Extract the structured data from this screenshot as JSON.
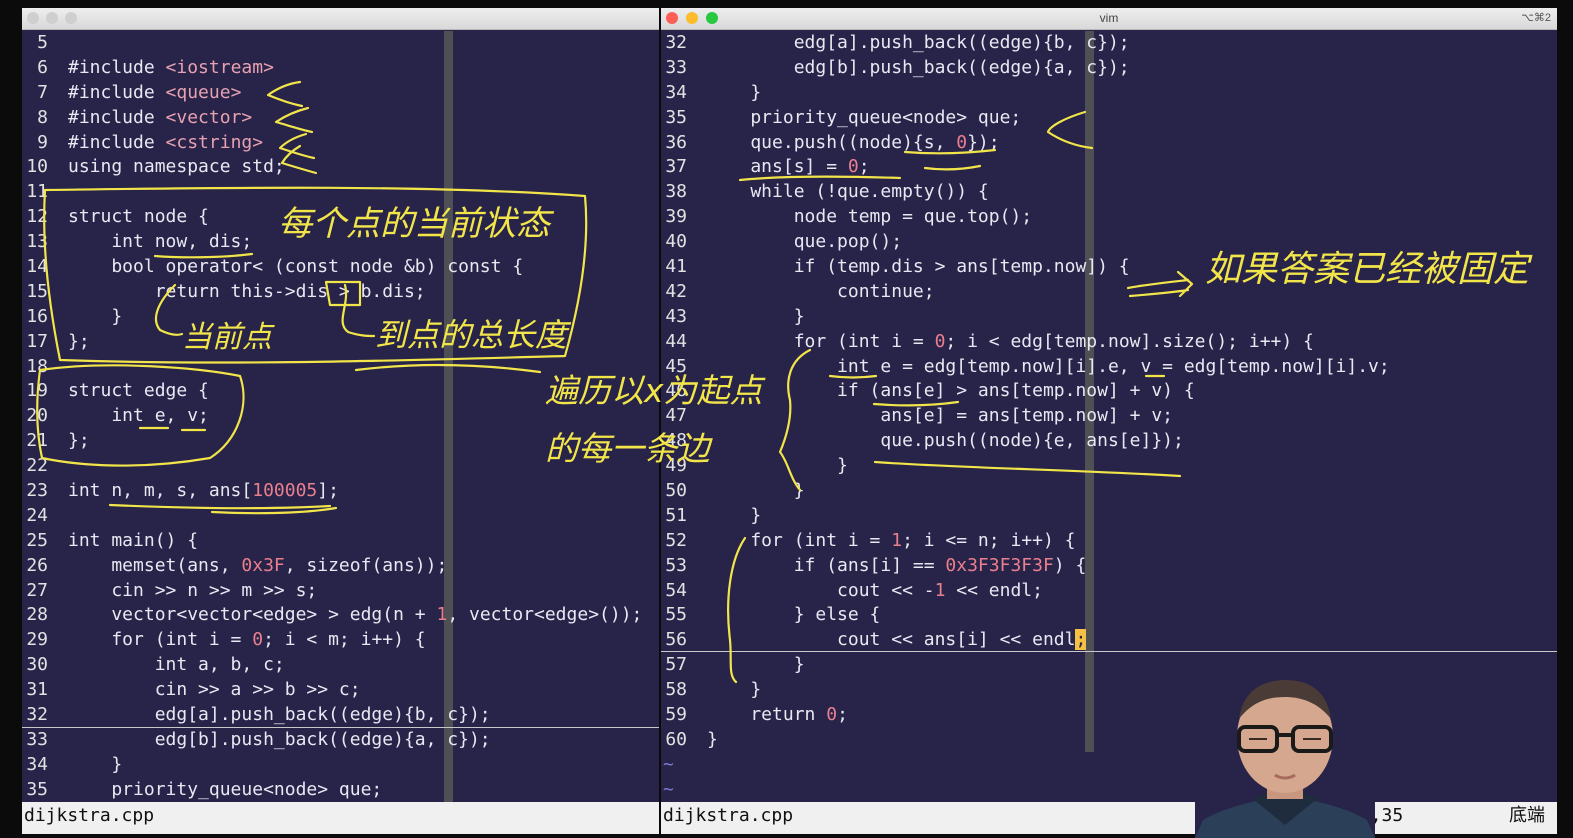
{
  "left_pane": {
    "file_name": "dijkstra.cpp",
    "lines": [
      {
        "n": "5",
        "segs": []
      },
      {
        "n": "6",
        "segs": [
          {
            "t": "#include ",
            "c": "k"
          },
          {
            "t": "<iostream>",
            "c": "s"
          }
        ]
      },
      {
        "n": "7",
        "segs": [
          {
            "t": "#include ",
            "c": "k"
          },
          {
            "t": "<queue>",
            "c": "s"
          }
        ]
      },
      {
        "n": "8",
        "segs": [
          {
            "t": "#include ",
            "c": "k"
          },
          {
            "t": "<vector>",
            "c": "s"
          }
        ]
      },
      {
        "n": "9",
        "segs": [
          {
            "t": "#include ",
            "c": "k"
          },
          {
            "t": "<cstring>",
            "c": "s"
          }
        ]
      },
      {
        "n": "10",
        "segs": [
          {
            "t": "using namespace std;",
            "c": "k"
          }
        ]
      },
      {
        "n": "11",
        "segs": []
      },
      {
        "n": "12",
        "segs": [
          {
            "t": "struct node {",
            "c": "k"
          }
        ]
      },
      {
        "n": "13",
        "segs": [
          {
            "t": "    int now, dis;",
            "c": "k"
          }
        ]
      },
      {
        "n": "14",
        "segs": [
          {
            "t": "    bool operator< (const node &b) const {",
            "c": "k"
          }
        ]
      },
      {
        "n": "15",
        "segs": [
          {
            "t": "        return this->dis > b.dis;",
            "c": "k"
          }
        ]
      },
      {
        "n": "16",
        "segs": [
          {
            "t": "    }",
            "c": "k"
          }
        ]
      },
      {
        "n": "17",
        "segs": [
          {
            "t": "};",
            "c": "k"
          }
        ]
      },
      {
        "n": "18",
        "segs": []
      },
      {
        "n": "19",
        "segs": [
          {
            "t": "struct edge {",
            "c": "k"
          }
        ]
      },
      {
        "n": "20",
        "segs": [
          {
            "t": "    int e, v;",
            "c": "k"
          }
        ]
      },
      {
        "n": "21",
        "segs": [
          {
            "t": "};",
            "c": "k"
          }
        ]
      },
      {
        "n": "22",
        "segs": []
      },
      {
        "n": "23",
        "segs": [
          {
            "t": "int n, m, s, ans[",
            "c": "k"
          },
          {
            "t": "100005",
            "c": "n"
          },
          {
            "t": "];",
            "c": "k"
          }
        ]
      },
      {
        "n": "24",
        "segs": []
      },
      {
        "n": "25",
        "segs": [
          {
            "t": "int main() {",
            "c": "k"
          }
        ]
      },
      {
        "n": "26",
        "segs": [
          {
            "t": "    memset(ans, ",
            "c": "k"
          },
          {
            "t": "0x3F",
            "c": "n"
          },
          {
            "t": ", sizeof(ans));",
            "c": "k"
          }
        ]
      },
      {
        "n": "27",
        "segs": [
          {
            "t": "    cin >> n >> m >> s;",
            "c": "k"
          }
        ]
      },
      {
        "n": "28",
        "segs": [
          {
            "t": "    vector<vector<edge> > edg(n + ",
            "c": "k"
          },
          {
            "t": "1",
            "c": "n"
          },
          {
            "t": ", vector<edge>());",
            "c": "k"
          }
        ]
      },
      {
        "n": "29",
        "segs": [
          {
            "t": "    for (int i = ",
            "c": "k"
          },
          {
            "t": "0",
            "c": "n"
          },
          {
            "t": "; i < m; i++) {",
            "c": "k"
          }
        ]
      },
      {
        "n": "30",
        "segs": [
          {
            "t": "        int a, b, c;",
            "c": "k"
          }
        ]
      },
      {
        "n": "31",
        "segs": [
          {
            "t": "        cin >> a >> b >> c;",
            "c": "k"
          }
        ]
      },
      {
        "n": "32",
        "segs": [
          {
            "t": "        edg[a].push_back((edge){b, c});",
            "c": "k"
          }
        ]
      },
      {
        "n": "33",
        "segs": [
          {
            "t": "        edg[b].push_back((edge){a, c});",
            "c": "k"
          }
        ]
      },
      {
        "n": "34",
        "segs": [
          {
            "t": "    }",
            "c": "k"
          }
        ]
      },
      {
        "n": "35",
        "segs": [
          {
            "t": "    priority_queue<node> que;",
            "c": "k"
          }
        ]
      }
    ]
  },
  "right_pane": {
    "window_title": "vim",
    "shortcut": "⌥⌘2",
    "file_name": "dijkstra.cpp",
    "cursor_position": "56,35",
    "scroll_position": "底端",
    "tilde_lines": [
      "~",
      "~"
    ],
    "lines": [
      {
        "n": "32",
        "segs": [
          {
            "t": "        edg[a].push_back((edge){b, c});",
            "c": "k"
          }
        ]
      },
      {
        "n": "33",
        "segs": [
          {
            "t": "        edg[b].push_back((edge){a, c});",
            "c": "k"
          }
        ]
      },
      {
        "n": "34",
        "segs": [
          {
            "t": "    }",
            "c": "k"
          }
        ]
      },
      {
        "n": "35",
        "segs": [
          {
            "t": "    priority_queue<node> que;",
            "c": "k"
          }
        ]
      },
      {
        "n": "36",
        "segs": [
          {
            "t": "    que.push((node){s, ",
            "c": "k"
          },
          {
            "t": "0",
            "c": "n"
          },
          {
            "t": "});",
            "c": "k"
          }
        ]
      },
      {
        "n": "37",
        "segs": [
          {
            "t": "    ans[s] = ",
            "c": "k"
          },
          {
            "t": "0",
            "c": "n"
          },
          {
            "t": ";",
            "c": "k"
          }
        ]
      },
      {
        "n": "38",
        "segs": [
          {
            "t": "    while (!que.empty()) {",
            "c": "k"
          }
        ]
      },
      {
        "n": "39",
        "segs": [
          {
            "t": "        node temp = que.top();",
            "c": "k"
          }
        ]
      },
      {
        "n": "40",
        "segs": [
          {
            "t": "        que.pop();",
            "c": "k"
          }
        ]
      },
      {
        "n": "41",
        "segs": [
          {
            "t": "        if (temp.dis > ans[temp.now]) {",
            "c": "k"
          }
        ]
      },
      {
        "n": "42",
        "segs": [
          {
            "t": "            continue;",
            "c": "k"
          }
        ]
      },
      {
        "n": "43",
        "segs": [
          {
            "t": "        }",
            "c": "k"
          }
        ]
      },
      {
        "n": "44",
        "segs": [
          {
            "t": "        for (int i = ",
            "c": "k"
          },
          {
            "t": "0",
            "c": "n"
          },
          {
            "t": "; i < edg[temp.now].size(); i++) {",
            "c": "k"
          }
        ]
      },
      {
        "n": "45",
        "segs": [
          {
            "t": "            int e = edg[temp.now][i].e, v = edg[temp.now][i].v;",
            "c": "k"
          }
        ]
      },
      {
        "n": "46",
        "segs": [
          {
            "t": "            if (ans[e] > ans[temp.now] + v) {",
            "c": "k"
          }
        ]
      },
      {
        "n": "47",
        "segs": [
          {
            "t": "                ans[e] = ans[temp.now] + v;",
            "c": "k"
          }
        ]
      },
      {
        "n": "48",
        "segs": [
          {
            "t": "                que.push((node){e, ans[e]});",
            "c": "k"
          }
        ]
      },
      {
        "n": "49",
        "segs": [
          {
            "t": "            }",
            "c": "k"
          }
        ]
      },
      {
        "n": "50",
        "segs": [
          {
            "t": "        }",
            "c": "k"
          }
        ]
      },
      {
        "n": "51",
        "segs": [
          {
            "t": "    }",
            "c": "k"
          }
        ]
      },
      {
        "n": "52",
        "segs": [
          {
            "t": "    for (int i = ",
            "c": "k"
          },
          {
            "t": "1",
            "c": "n"
          },
          {
            "t": "; i <= n; i++) {",
            "c": "k"
          }
        ]
      },
      {
        "n": "53",
        "segs": [
          {
            "t": "        if (ans[i] == ",
            "c": "k"
          },
          {
            "t": "0x3F3F3F3F",
            "c": "n"
          },
          {
            "t": ") {",
            "c": "k"
          }
        ]
      },
      {
        "n": "54",
        "segs": [
          {
            "t": "            cout << -",
            "c": "k"
          },
          {
            "t": "1",
            "c": "n"
          },
          {
            "t": " << endl;",
            "c": "k"
          }
        ]
      },
      {
        "n": "55",
        "segs": [
          {
            "t": "        } else {",
            "c": "k"
          }
        ]
      },
      {
        "n": "56",
        "segs": [
          {
            "t": "            cout << ans[i] << endl",
            "c": "k"
          },
          {
            "t": ";",
            "c": "cur"
          }
        ]
      },
      {
        "n": "57",
        "segs": [
          {
            "t": "        }",
            "c": "k"
          }
        ]
      },
      {
        "n": "58",
        "segs": [
          {
            "t": "    }",
            "c": "k"
          }
        ]
      },
      {
        "n": "59",
        "segs": [
          {
            "t": "    return ",
            "c": "k"
          },
          {
            "t": "0",
            "c": "n"
          },
          {
            "t": ";",
            "c": "k"
          }
        ]
      },
      {
        "n": "60",
        "segs": [
          {
            "t": "}",
            "c": "k"
          }
        ]
      }
    ]
  },
  "annotations": {
    "node_struct": "每个点的当前状态",
    "current_point": "当前点",
    "distance": "到点的总长度",
    "edge_struct": "遍历以x为起点的每一条边",
    "already_fixed": "如果答案已经被固定"
  },
  "colors": {
    "editor_bg": "#272349",
    "string": "#e7a1b1",
    "number": "#ea7f8e",
    "cursor": "#f5c043",
    "ink": "#f2e54a",
    "statusbar_bg": "#f0f0f0"
  }
}
